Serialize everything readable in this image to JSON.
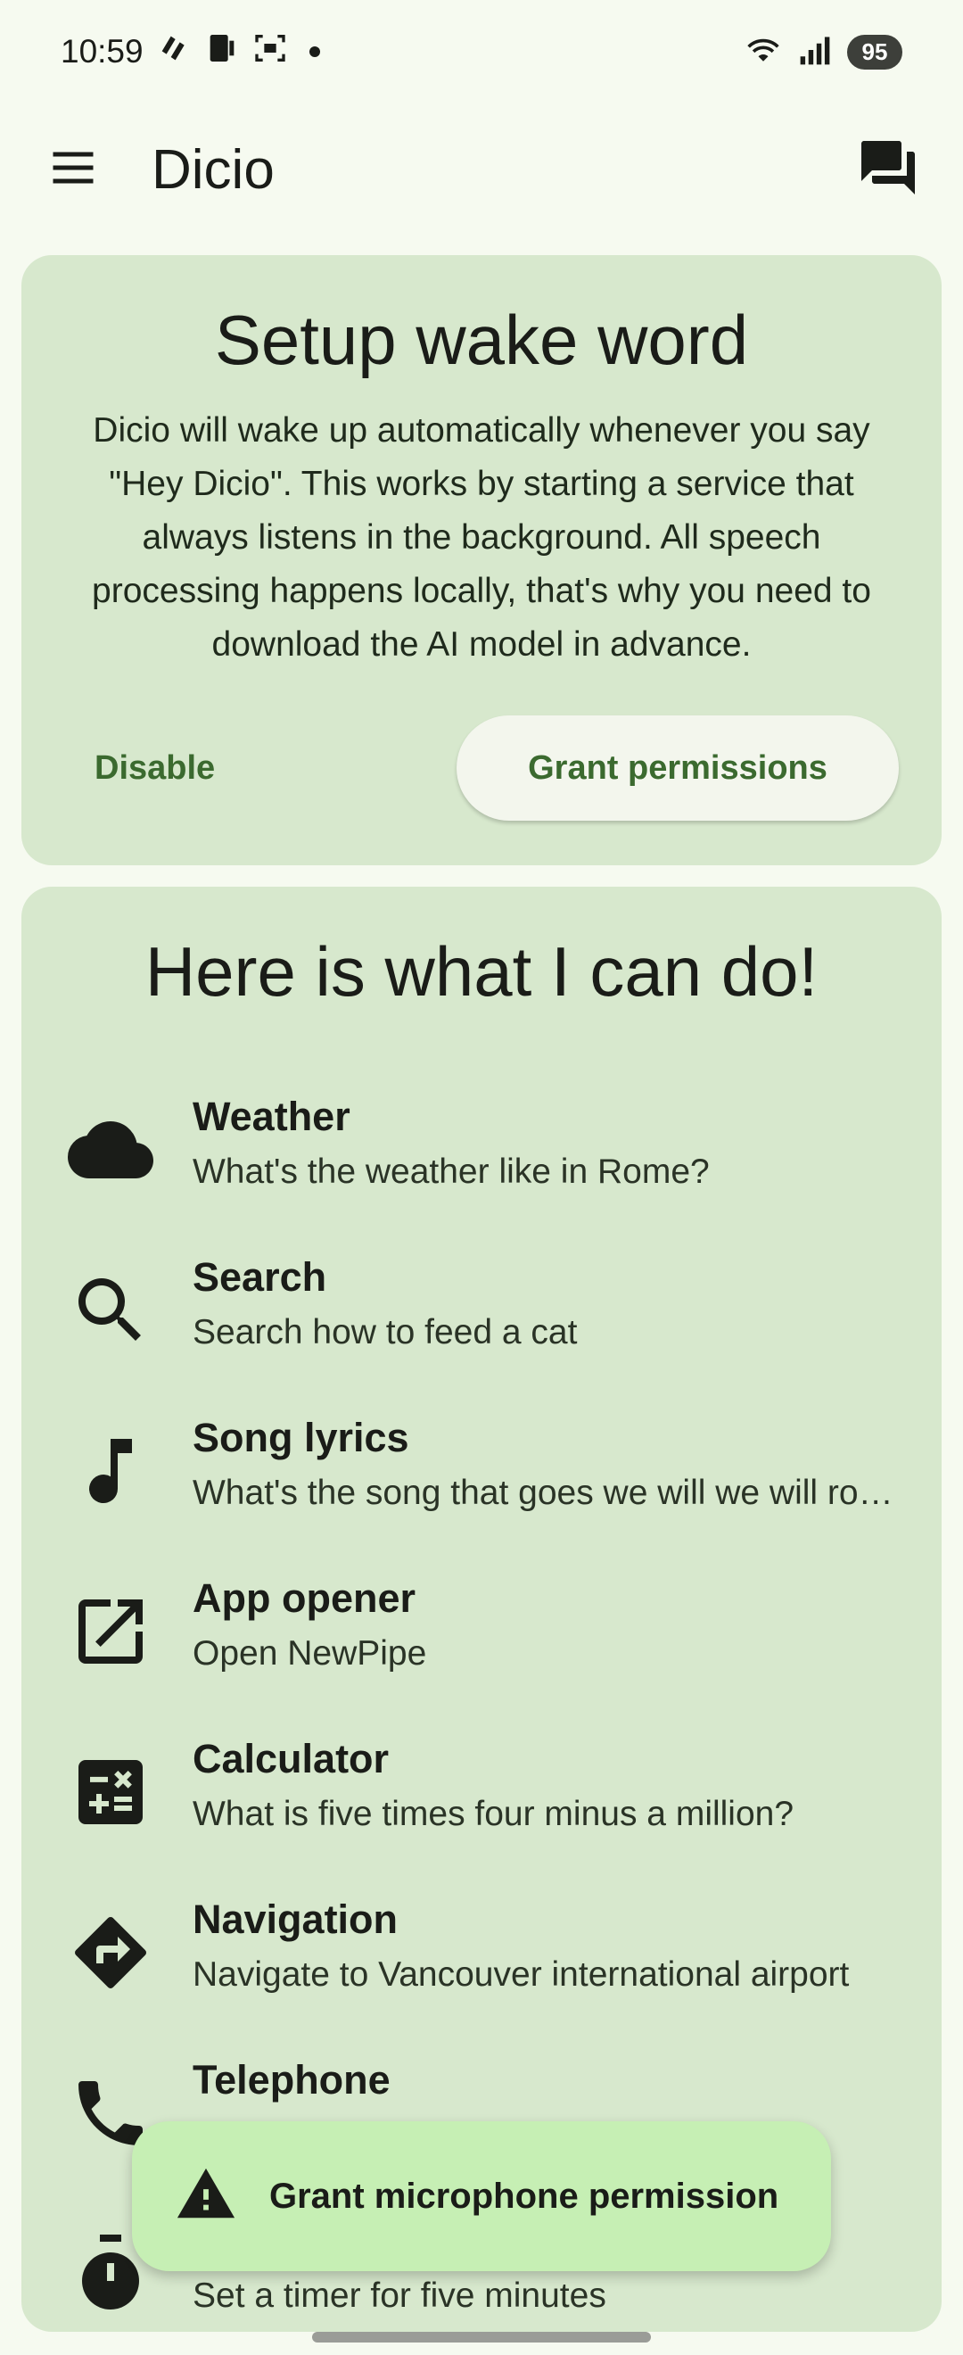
{
  "status_bar": {
    "time": "10:59",
    "battery": "95"
  },
  "app_bar": {
    "title": "Dicio"
  },
  "setup_card": {
    "title": "Setup wake word",
    "description": "Dicio will wake up automatically whenever you say \"Hey Dicio\". This works by starting a service that always listens in the background. All speech processing happens locally, that's why you need to download the AI model in advance.",
    "disable_label": "Disable",
    "grant_label": "Grant permissions"
  },
  "skills_card": {
    "title": "Here is what I can do!",
    "items": [
      {
        "name": "Weather",
        "example": "What's the weather like in Rome?",
        "icon": "cloud-icon"
      },
      {
        "name": "Search",
        "example": "Search how to feed a cat",
        "icon": "search-icon"
      },
      {
        "name": "Song lyrics",
        "example": "What's the song that goes we will we will rock you?",
        "icon": "music-note-icon"
      },
      {
        "name": "App opener",
        "example": "Open NewPipe",
        "icon": "open-in-new-icon"
      },
      {
        "name": "Calculator",
        "example": "What is five times four minus a million?",
        "icon": "calculator-icon"
      },
      {
        "name": "Navigation",
        "example": "Navigate to Vancouver international airport",
        "icon": "directions-icon"
      },
      {
        "name": "Telephone",
        "example": "",
        "icon": "phone-icon"
      },
      {
        "name": "",
        "example": "Set a timer for five minutes",
        "icon": "timer-icon"
      }
    ]
  },
  "snackbar": {
    "text": "Grant microphone permission",
    "icon": "warning-icon"
  },
  "colors": {
    "background": "#f6faf0",
    "card": "#d7e8cd",
    "accent": "#3b6a2f",
    "snackbar": "#c6efb4"
  }
}
